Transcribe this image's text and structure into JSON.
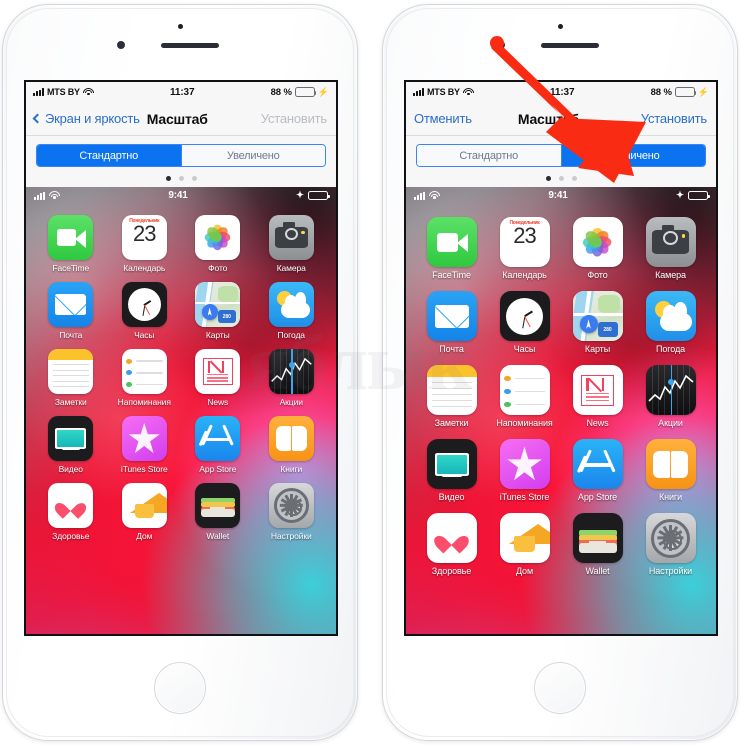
{
  "page": {
    "watermark": "яблык",
    "annotation": {
      "type": "red-arrow",
      "color": "#f92c13",
      "points_to": "Увеличено segment on right phone"
    }
  },
  "phones": [
    {
      "id": "left",
      "label": "standard-display-zoom",
      "status_bar": {
        "carrier": "MTS BY",
        "time": "11:37",
        "battery_percent": "88 %",
        "charging": true,
        "signal_bars": 4,
        "wifi": true
      },
      "navbar": {
        "back_label": "Экран и яркость",
        "title": "Масштаб",
        "action_label": "Установить",
        "action_enabled": false,
        "has_back_chevron": true,
        "has_cancel": false
      },
      "segmented": {
        "options": [
          "Стандартно",
          "Увеличено"
        ],
        "selected_index": 0
      },
      "page_dots": {
        "count": 3,
        "active_index": 0
      },
      "home_screen": {
        "status_bar": {
          "time": "9:41",
          "bluetooth": true,
          "signal_bars": 4,
          "wifi": true
        },
        "zoomed": false,
        "apps": [
          {
            "name": "FaceTime",
            "icon": "facetime-icon"
          },
          {
            "name": "Календарь",
            "icon": "calendar-icon",
            "weekday": "Понедельник",
            "day": "23"
          },
          {
            "name": "Фото",
            "icon": "photos-icon"
          },
          {
            "name": "Камера",
            "icon": "camera-icon"
          },
          {
            "name": "Почта",
            "icon": "mail-icon"
          },
          {
            "name": "Часы",
            "icon": "clock-icon"
          },
          {
            "name": "Карты",
            "icon": "maps-icon",
            "badge": "280"
          },
          {
            "name": "Погода",
            "icon": "weather-icon"
          },
          {
            "name": "Заметки",
            "icon": "notes-icon"
          },
          {
            "name": "Напоминания",
            "icon": "reminders-icon"
          },
          {
            "name": "News",
            "icon": "news-icon"
          },
          {
            "name": "Акции",
            "icon": "stocks-icon"
          },
          {
            "name": "Видео",
            "icon": "video-icon"
          },
          {
            "name": "iTunes Store",
            "icon": "itunes-store-icon"
          },
          {
            "name": "App Store",
            "icon": "app-store-icon"
          },
          {
            "name": "Книги",
            "icon": "books-icon"
          },
          {
            "name": "Здоровье",
            "icon": "health-icon"
          },
          {
            "name": "Дом",
            "icon": "home-icon"
          },
          {
            "name": "Wallet",
            "icon": "wallet-icon"
          },
          {
            "name": "Настройки",
            "icon": "settings-icon"
          }
        ]
      }
    },
    {
      "id": "right",
      "label": "zoomed-display-zoom",
      "status_bar": {
        "carrier": "MTS BY",
        "time": "11:37",
        "battery_percent": "88 %",
        "charging": true,
        "signal_bars": 4,
        "wifi": true
      },
      "navbar": {
        "back_label": "Отменить",
        "title": "Масштаб",
        "action_label": "Установить",
        "action_enabled": true,
        "has_back_chevron": false,
        "has_cancel": true
      },
      "segmented": {
        "options": [
          "Стандартно",
          "Увеличено"
        ],
        "selected_index": 1
      },
      "page_dots": {
        "count": 3,
        "active_index": 0
      },
      "home_screen": {
        "status_bar": {
          "time": "9:41",
          "bluetooth": true,
          "signal_bars": 4,
          "wifi": true
        },
        "zoomed": true,
        "apps": [
          {
            "name": "FaceTime",
            "icon": "facetime-icon"
          },
          {
            "name": "Календарь",
            "icon": "calendar-icon",
            "weekday": "Понедельник",
            "day": "23"
          },
          {
            "name": "Фото",
            "icon": "photos-icon"
          },
          {
            "name": "Камера",
            "icon": "camera-icon"
          },
          {
            "name": "Почта",
            "icon": "mail-icon"
          },
          {
            "name": "Часы",
            "icon": "clock-icon"
          },
          {
            "name": "Карты",
            "icon": "maps-icon",
            "badge": "280"
          },
          {
            "name": "Погода",
            "icon": "weather-icon"
          },
          {
            "name": "Заметки",
            "icon": "notes-icon"
          },
          {
            "name": "Напоминания",
            "icon": "reminders-icon"
          },
          {
            "name": "News",
            "icon": "news-icon"
          },
          {
            "name": "Акции",
            "icon": "stocks-icon"
          },
          {
            "name": "Видео",
            "icon": "video-icon"
          },
          {
            "name": "iTunes Store",
            "icon": "itunes-store-icon"
          },
          {
            "name": "App Store",
            "icon": "app-store-icon"
          },
          {
            "name": "Книги",
            "icon": "books-icon"
          },
          {
            "name": "Здоровье",
            "icon": "health-icon"
          },
          {
            "name": "Дом",
            "icon": "home-icon"
          },
          {
            "name": "Wallet",
            "icon": "wallet-icon"
          },
          {
            "name": "Настройки",
            "icon": "settings-icon"
          }
        ]
      }
    }
  ],
  "colors": {
    "accent_blue": "#0b72f0",
    "link_blue": "#2b6ecb",
    "arrow_red": "#f92c13",
    "battery_green": "#4cd763",
    "disabled_gray": "#b9bcc2"
  }
}
